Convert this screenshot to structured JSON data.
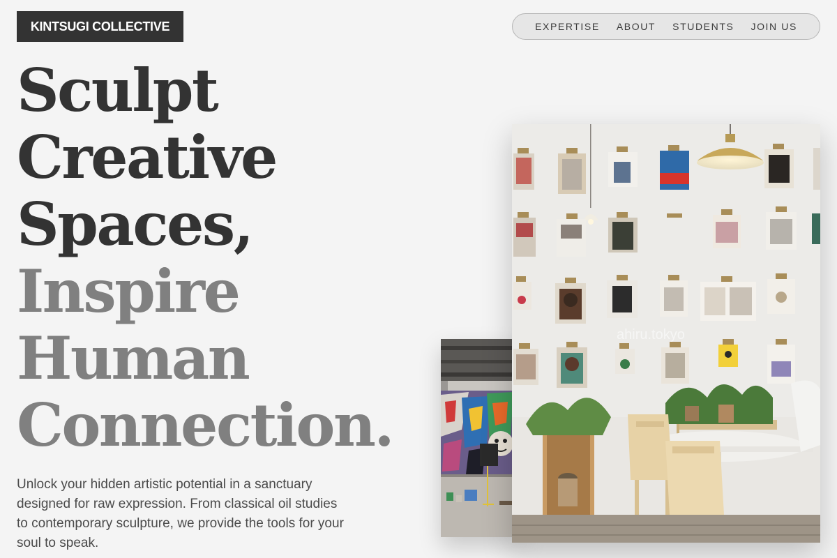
{
  "brand": {
    "name": "KINTSUGI COLLECTIVE"
  },
  "nav": {
    "items": [
      {
        "label": "EXPERTISE"
      },
      {
        "label": "ABOUT"
      },
      {
        "label": "STUDENTS"
      },
      {
        "label": "JOIN US"
      }
    ]
  },
  "hero": {
    "headline_dark": [
      "Sculpt",
      "Creative",
      "Spaces,"
    ],
    "headline_light": [
      "Inspire",
      "Human",
      "Connection."
    ],
    "intro": "Unlock your hidden artistic potential in a sanctuary designed for raw expression. From classical oil studies to contemporary sculpture, we provide the tools for your soul to speak."
  },
  "images": {
    "front_watermark": "ahiru.tokyo"
  },
  "colors": {
    "background": "#f4f4f4",
    "logo_bg": "#333333",
    "headline_dark": "#333333",
    "headline_light": "#808080",
    "nav_bg": "#e6e6e6"
  }
}
